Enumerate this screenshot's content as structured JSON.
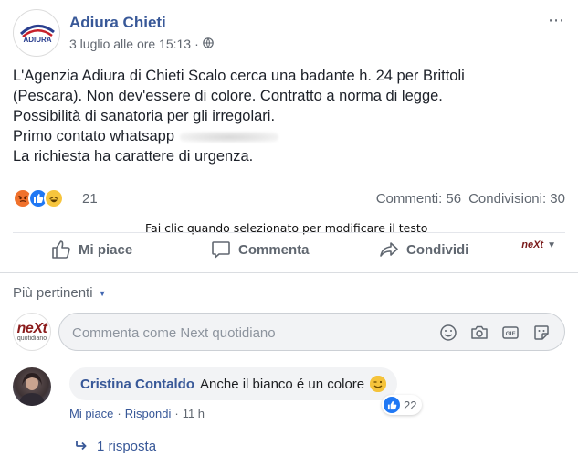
{
  "post": {
    "page_name": "Adiura Chieti",
    "page_logo_text": "ADIURA",
    "date": "3 luglio alle ore 15:13",
    "separator": "·",
    "more_icon": "⋯",
    "body_lines": [
      "L'Agenzia Adiura di Chieti Scalo cerca una badante h. 24 per Brittoli",
      "(Pescara). Non dev'essere di colore. Contratto a norma di legge.",
      "Possibilità di sanatoria per gli irregolari.",
      "Primo contato whatsapp",
      "La richiesta ha carattere di urgenza."
    ],
    "reaction_count": "21",
    "reactions": [
      "angry-icon",
      "like-icon",
      "haha-icon"
    ],
    "comments_count": "Commenti: 56",
    "shares_count": "Condivisioni: 30"
  },
  "tooltip": "Fai clic quando selezionato per modificare il testo",
  "actions": {
    "like": "Mi piace",
    "comment": "Commenta",
    "share": "Condividi"
  },
  "share_as_logo": "neXt",
  "filter": {
    "label": "Più pertinenti"
  },
  "composer": {
    "avatar_logo": "neXt",
    "avatar_sub": "quotidiano",
    "placeholder": "Commenta come Next quotidiano"
  },
  "comments": [
    {
      "author": "Cristina Contaldo",
      "text": "Anche il bianco é un colore",
      "like_count": "22",
      "actions": {
        "like": "Mi piace",
        "sep": "·",
        "reply": "Rispondi",
        "time": "11 h"
      },
      "replies_label": "1 risposta"
    }
  ],
  "colors": {
    "link_blue": "#385898",
    "meta_gray": "#606770",
    "like_blue": "#2078f4",
    "angry_orange": "#f0712c",
    "haha_yellow": "#f7c53d"
  }
}
